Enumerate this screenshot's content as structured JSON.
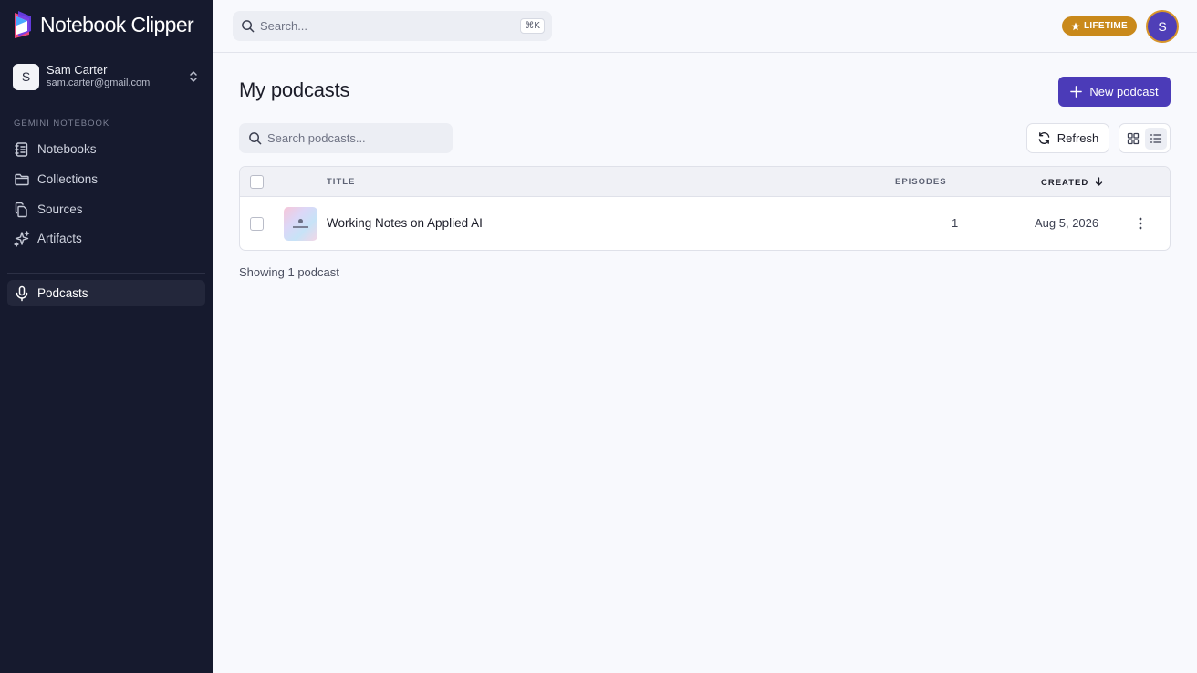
{
  "brand": {
    "name": "Notebook Clipper"
  },
  "user": {
    "initial": "S",
    "name": "Sam Carter",
    "email": "sam.carter@gmail.com"
  },
  "sidebar": {
    "section_label": "GEMINI NOTEBOOK",
    "items": [
      {
        "label": "Notebooks",
        "icon": "notebook-icon"
      },
      {
        "label": "Collections",
        "icon": "folder-icon"
      },
      {
        "label": "Sources",
        "icon": "files-icon"
      },
      {
        "label": "Artifacts",
        "icon": "sparkles-icon"
      }
    ],
    "podcasts_label": "Podcasts"
  },
  "topbar": {
    "search_placeholder": "Search...",
    "shortcut": "⌘K",
    "badge": "LIFETIME",
    "avatar_initial": "S"
  },
  "main": {
    "title": "My podcasts",
    "new_button": "New podcast",
    "search_placeholder": "Search podcasts...",
    "refresh_label": "Refresh",
    "table": {
      "headers": {
        "title": "TITLE",
        "episodes": "EPISODES",
        "created": "CREATED"
      },
      "rows": [
        {
          "title": "Working Notes on Applied AI",
          "episodes": "1",
          "created": "Aug 5, 2026"
        }
      ]
    },
    "showing": "Showing 1 podcast"
  },
  "colors": {
    "sidebar_bg": "#161a2e",
    "accent": "#4b3bb8",
    "badge": "#c9891b"
  }
}
